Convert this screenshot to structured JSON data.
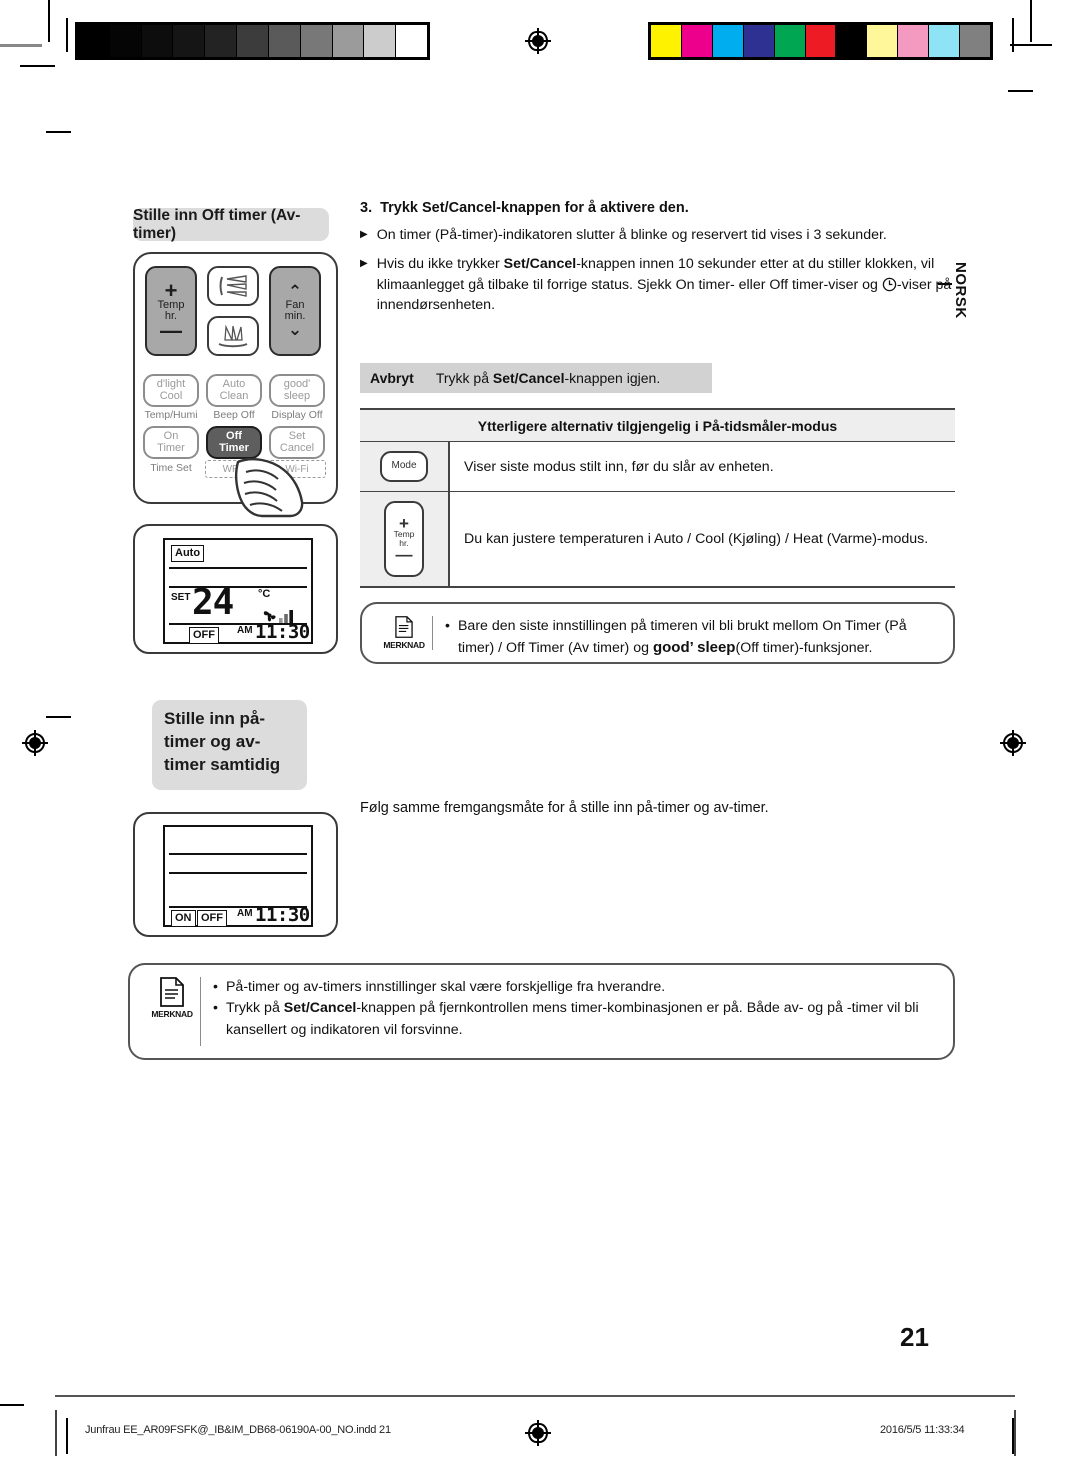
{
  "document": {
    "language_tab": "NORSK",
    "page_number": "21",
    "footer_left": "Junfrau EE_AR09FSFK@_IB&IM_DB68-06190A-00_NO.indd   21",
    "footer_right": "2016/5/5   11:33:34"
  },
  "calibration": {
    "gray_patches": [
      "#000000",
      "#050505",
      "#0d0d0d",
      "#151515",
      "#232323",
      "#3c3c3c",
      "#5a5a5a",
      "#787878",
      "#9b9b9b",
      "#cccccc",
      "#ffffff"
    ],
    "color_patches": [
      "#fff200",
      "#ec008c",
      "#00aeef",
      "#2e3192",
      "#00a651",
      "#ed1c24",
      "#000000",
      "#fff799",
      "#f49ac1",
      "#8ee3f5",
      "#808080"
    ]
  },
  "section_off_timer": {
    "heading": "Stille inn Off timer (Av-timer)",
    "remote": {
      "buttons": [
        {
          "name": "temp-hr",
          "plus": "+",
          "label_1": "Temp",
          "label_2": "hr.",
          "minus": "—",
          "style": "gray"
        },
        {
          "name": "swing-vertical",
          "style": "outline"
        },
        {
          "name": "swing-horizontal",
          "style": "outline"
        },
        {
          "name": "fan-min",
          "chev_up": "⌃",
          "label_1": "Fan",
          "label_2": "min.",
          "chev_down": "⌄",
          "style": "gray"
        },
        {
          "name": "dlight-cool",
          "label_1": "d'light",
          "label_2": "Cool",
          "sub": "Temp/Humi",
          "style": "pale"
        },
        {
          "name": "auto-clean",
          "label_1": "Auto",
          "label_2": "Clean",
          "sub": "Beep Off",
          "style": "pale"
        },
        {
          "name": "good-sleep",
          "label_1": "good'",
          "label_2": "sleep",
          "sub": "Display Off",
          "style": "pale"
        },
        {
          "name": "on-timer",
          "label_1": "On",
          "label_2": "Timer",
          "sub": "Time Set",
          "style": "pale"
        },
        {
          "name": "off-timer",
          "label_1": "Off",
          "label_2": "Timer",
          "sub": "WPS",
          "style": "dark"
        },
        {
          "name": "set-cancel",
          "label_1": "Set",
          "label_2": "Cancel",
          "sub": "Wi-Fi",
          "style": "pale"
        }
      ]
    },
    "lcd": {
      "mode_tag": "Auto",
      "set_label": "SET",
      "temperature": "24",
      "unit": "°C",
      "state_tag": "OFF",
      "meridiem": "AM",
      "time": "11:30"
    }
  },
  "step": {
    "number": "3.",
    "title_pre": "Trykk ",
    "title_bold": "Set/Cancel",
    "title_post": "-knappen for å aktivere den.",
    "bullets": [
      {
        "text": "On timer (På-timer)-indikatoren slutter å blinke og reservert tid vises i 3 sekunder."
      },
      {
        "text_a": "Hvis du ikke trykker ",
        "bold": "Set/Cancel",
        "text_b": "-knappen innen 10 sekunder etter at du stiller klokken, vil klimaanlegget gå tilbake til forrige status. Sjekk On timer- eller Off timer-viser og ",
        "text_c": "-viser på innendørsenheten.",
        "inline_icon": "clock-icon"
      }
    ]
  },
  "cancel_row": {
    "label": "Avbryt",
    "text_pre": "Trykk på ",
    "text_bold": "Set/Cancel",
    "text_post": "-knappen igjen."
  },
  "table": {
    "header": "Ytterligere alternativ tilgjengelig i På-tidsmåler-modus",
    "rows": [
      {
        "icon": "mode-button-icon",
        "icon_label": "Mode",
        "text": "Viser siste modus stilt inn, før du slår av enheten."
      },
      {
        "icon": "temp-hr-button-icon",
        "icon_plus": "+",
        "icon_label_1": "Temp",
        "icon_label_2": "hr.",
        "icon_minus": "—",
        "text": "Du kan justere temperaturen i Auto / Cool (Kjøling) / Heat (Varme)-modus."
      }
    ]
  },
  "note_top": {
    "icon_caption": "MERKNAD",
    "items": [
      {
        "bullet": "•",
        "text_a": "Bare den siste innstillingen på timeren vil bli brukt mellom On Timer (På timer) / Off Timer (Av timer) og ",
        "bold": "good’ sleep",
        "text_b": "(Off timer)-funksjoner."
      }
    ]
  },
  "section_both_timers": {
    "heading": "Stille inn på-timer og av-timer samtidig",
    "lcd": {
      "tag_on": "ON",
      "tag_off": "OFF",
      "meridiem": "AM",
      "time": "11:30"
    },
    "body_text": "Følg samme fremgangsmåte for å stille inn på-timer og av-timer."
  },
  "note_bottom": {
    "icon_caption": "MERKNAD",
    "items": [
      {
        "bullet": "•",
        "text_a": "På-timer og av-timers innstillinger skal være forskjellige fra hverandre.",
        "bold": "",
        "text_b": ""
      },
      {
        "bullet": "•",
        "text_a": "Trykk på ",
        "bold": "Set/Cancel",
        "text_b": "-knappen på fjernkontrollen mens timer-kombinasjonen er på. Både av- og på -timer vil bli kansellert og indikatoren vil forsvinne."
      }
    ]
  }
}
